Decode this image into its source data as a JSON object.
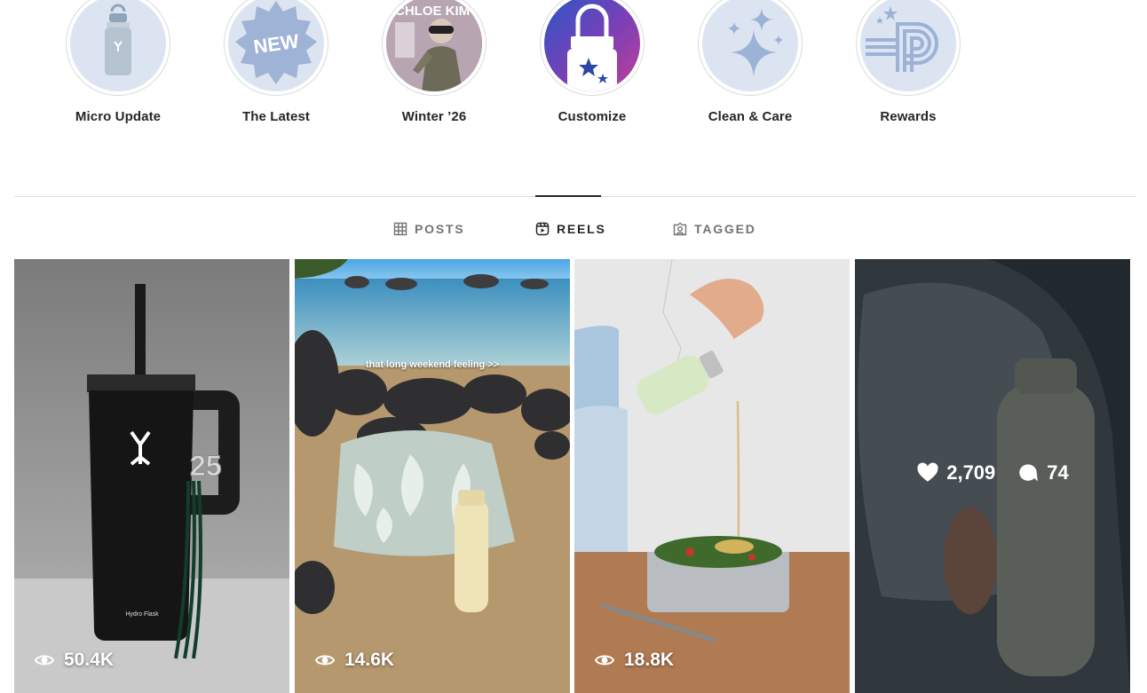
{
  "highlights": [
    {
      "label": "Micro Update",
      "icon": "bottle-icon"
    },
    {
      "label": "The Latest",
      "icon": "new-badge-icon",
      "badge_text": "NEW"
    },
    {
      "label": "Winter ’26",
      "icon": "snowboarder-photo",
      "cover_text": "CHLOE KIM"
    },
    {
      "label": "Customize",
      "icon": "custom-bottle-icon"
    },
    {
      "label": "Clean & Care",
      "icon": "sparkle-icon"
    },
    {
      "label": "Rewards",
      "icon": "rewards-logo-icon"
    }
  ],
  "tabs": [
    {
      "label": "POSTS",
      "icon": "grid-icon",
      "active": false
    },
    {
      "label": "REELS",
      "icon": "reels-icon",
      "active": true
    },
    {
      "label": "TAGGED",
      "icon": "tagged-icon",
      "active": false
    }
  ],
  "reels": [
    {
      "views": "50.4K",
      "scene": "black tumbler with graduation tassel",
      "bottle_text": "Hydro Flask",
      "charm_text": "25"
    },
    {
      "views": "14.6K",
      "scene": "beach with bag and bottle",
      "overlay": "that long weekend feeling >>"
    },
    {
      "views": "18.8K",
      "scene": "pouring dressing onto salad"
    },
    {
      "likes": "2,709",
      "comments": "74",
      "scene": "bottle near airplane window",
      "hovered": true
    }
  ],
  "colors": {
    "text": "#262626",
    "muted": "#737373",
    "divider": "#dbdbdb",
    "highlight_bg": "#dbe4f0",
    "highlight_fg": "#8ea6cf"
  }
}
